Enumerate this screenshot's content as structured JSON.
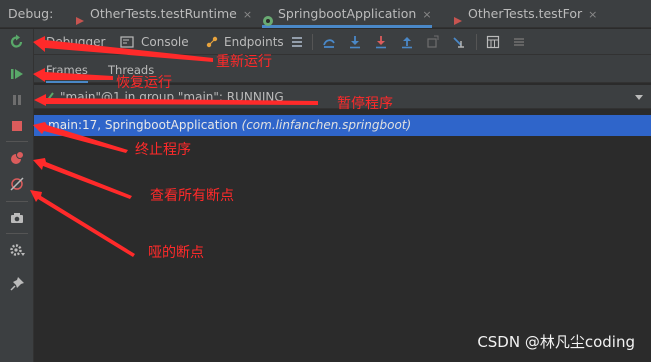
{
  "debug_label": "Debug:",
  "tabs": [
    {
      "label": "OtherTests.testRuntime",
      "close": "×"
    },
    {
      "label": "SpringbootApplication",
      "close": "×"
    },
    {
      "label": "OtherTests.testFor",
      "close": "×"
    }
  ],
  "toolbar": {
    "debugger_label": "Debugger",
    "console_label": "Console",
    "endpoints_label": "Endpoints"
  },
  "subtabs": {
    "frames_label": "Frames",
    "threads_label": "Threads"
  },
  "thread": {
    "text": "\"main\"@1 in group \"main\": RUNNING"
  },
  "frame": {
    "location": "main:17, SpringbootApplication",
    "package": "(com.linfanchen.springboot)"
  },
  "annotations": {
    "rerun": "重新运行",
    "resume": "恢复运行",
    "pause": "暂停程序",
    "stop": "终止程序",
    "view_breakpoints": "查看所有断点",
    "mute_breakpoints": "哑的断点"
  },
  "watermark": "CSDN @林凡尘coding",
  "colors": {
    "annotation": "#ff2a2a",
    "selection": "#2f65ca",
    "accent": "#4a88c7"
  }
}
